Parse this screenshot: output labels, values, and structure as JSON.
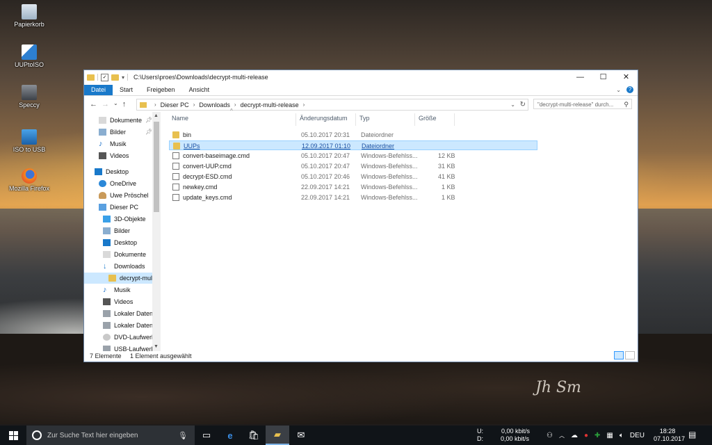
{
  "desktop": {
    "icons": [
      {
        "label": "Papierkorb",
        "icon": "recycle-bin-icon"
      },
      {
        "label": "UUPtoISO",
        "icon": "uuptoiso-icon"
      },
      {
        "label": "Speccy",
        "icon": "speccy-icon"
      },
      {
        "label": "ISO to USB",
        "icon": "iso-to-usb-icon"
      },
      {
        "label": "Mozilla Firefox",
        "icon": "firefox-icon"
      }
    ]
  },
  "window": {
    "title": "C:\\Users\\proes\\Downloads\\decrypt-multi-release",
    "controls": {
      "minimize": "—",
      "maximize": "☐",
      "close": "✕"
    },
    "ribbon": {
      "tabs": [
        "Datei",
        "Start",
        "Freigeben",
        "Ansicht"
      ],
      "help": "?"
    },
    "address": {
      "crumbs": [
        "Dieser PC",
        "Downloads",
        "decrypt-multi-release"
      ],
      "search_placeholder": "\"decrypt-multi-release\" durch..."
    },
    "tree": [
      {
        "label": "Dokumente",
        "icon": "documents-icon",
        "pinned": true
      },
      {
        "label": "Bilder",
        "icon": "pictures-icon",
        "pinned": true
      },
      {
        "label": "Musik",
        "icon": "music-icon",
        "pinned": false
      },
      {
        "label": "Videos",
        "icon": "videos-icon",
        "pinned": false
      },
      {
        "label": "Desktop",
        "icon": "desktop-icon",
        "pinned": false
      },
      {
        "label": "OneDrive",
        "icon": "onedrive-icon",
        "pinned": false
      },
      {
        "label": "Uwe Pröschel",
        "icon": "user-icon",
        "pinned": false
      },
      {
        "label": "Dieser PC",
        "icon": "this-pc-icon",
        "pinned": false
      },
      {
        "label": "3D-Objekte",
        "icon": "3d-objects-icon",
        "pinned": false
      },
      {
        "label": "Bilder",
        "icon": "pictures-icon",
        "pinned": false
      },
      {
        "label": "Desktop",
        "icon": "desktop-icon",
        "pinned": false
      },
      {
        "label": "Dokumente",
        "icon": "documents-icon",
        "pinned": false
      },
      {
        "label": "Downloads",
        "icon": "downloads-icon",
        "pinned": false
      },
      {
        "label": "decrypt-mult",
        "icon": "folder-icon",
        "pinned": false
      },
      {
        "label": "Musik",
        "icon": "music-icon",
        "pinned": false
      },
      {
        "label": "Videos",
        "icon": "videos-icon",
        "pinned": false
      },
      {
        "label": "Lokaler Datentr",
        "icon": "drive-icon",
        "pinned": false
      },
      {
        "label": "Lokaler Datentr",
        "icon": "drive-icon",
        "pinned": false
      },
      {
        "label": "DVD-Laufwerk",
        "icon": "dvd-icon",
        "pinned": false
      },
      {
        "label": "USB-Laufwerk",
        "icon": "usb-drive-icon",
        "pinned": false
      }
    ],
    "columns": {
      "name": "Name",
      "date": "Änderungsdatum",
      "type": "Typ",
      "size": "Größe"
    },
    "files": [
      {
        "name": "bin",
        "date": "05.10.2017 20:31",
        "type": "Dateiordner",
        "size": "",
        "kind": "folder"
      },
      {
        "name": "UUPs",
        "date": "12.09.2017 01:10",
        "type": "Dateiordner",
        "size": "",
        "kind": "folder"
      },
      {
        "name": "convert-baseimage.cmd",
        "date": "05.10.2017 20:47",
        "type": "Windows-Befehlss...",
        "size": "12 KB",
        "kind": "cmd"
      },
      {
        "name": "convert-UUP.cmd",
        "date": "05.10.2017 20:47",
        "type": "Windows-Befehlss...",
        "size": "31 KB",
        "kind": "cmd"
      },
      {
        "name": "decrypt-ESD.cmd",
        "date": "05.10.2017 20:46",
        "type": "Windows-Befehlss...",
        "size": "41 KB",
        "kind": "cmd"
      },
      {
        "name": "newkey.cmd",
        "date": "22.09.2017 14:21",
        "type": "Windows-Befehlss...",
        "size": "1 KB",
        "kind": "cmd"
      },
      {
        "name": "update_keys.cmd",
        "date": "22.09.2017 14:21",
        "type": "Windows-Befehlss...",
        "size": "1 KB",
        "kind": "cmd"
      }
    ],
    "status": {
      "count": "7 Elemente",
      "selected": "1 Element ausgewählt"
    }
  },
  "taskbar": {
    "search_placeholder": "Zur Suche Text hier eingeben",
    "net": {
      "up_label": "U:",
      "down_label": "D:",
      "up": "0,00 kbit/s",
      "down": "0,00 kbit/s"
    },
    "lang": "DEU",
    "time": "18:28",
    "date": "07.10.2017"
  },
  "signature": "Jh Sm",
  "colors": {
    "accent": "#1979ca",
    "selection": "#cce8ff",
    "folder": "#e8c04f"
  }
}
